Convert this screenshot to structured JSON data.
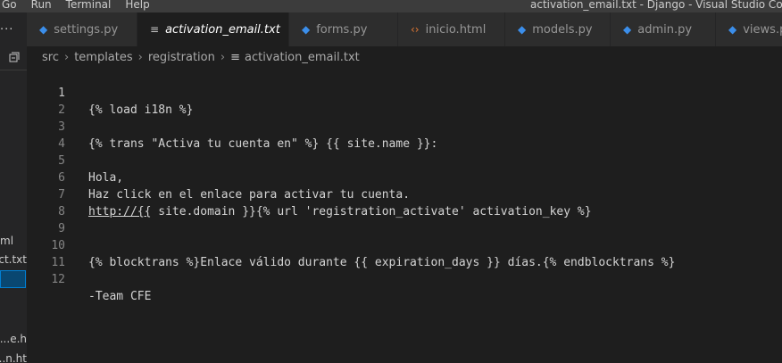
{
  "titlebar": {
    "menus": [
      "Go",
      "Run",
      "Terminal",
      "Help"
    ],
    "window_title": "activation_email.txt - Django - Visual Studio Code"
  },
  "sidebar": {
    "header": "...",
    "files": [
      "ml",
      "ct.txt",
      "e.h...",
      "n.ht..."
    ]
  },
  "tabs": [
    {
      "label": "settings.py",
      "icon": "python-file-icon",
      "color": "#3b8eea"
    },
    {
      "label": "activation_email.txt",
      "icon": "text-file-icon",
      "active": true
    },
    {
      "label": "forms.py",
      "icon": "python-file-icon",
      "color": "#3b8eea"
    },
    {
      "label": "inicio.html",
      "icon": "html-file-icon",
      "color": "#e37933"
    },
    {
      "label": "models.py",
      "icon": "python-file-icon",
      "color": "#3b8eea"
    },
    {
      "label": "admin.py",
      "icon": "python-file-icon",
      "color": "#3b8eea"
    },
    {
      "label": "views.p",
      "icon": "python-file-icon",
      "color": "#3b8eea"
    }
  ],
  "close_glyph": "✕",
  "breadcrumb": [
    "src",
    "templates",
    "registration",
    "activation_email.txt"
  ],
  "editor": {
    "current_line": 1,
    "lines": [
      {
        "n": "1",
        "text": "{% load i18n %}"
      },
      {
        "n": "2",
        "text": ""
      },
      {
        "n": "3",
        "text": "{% trans \"Activa tu cuenta en\" %} {{ site.name }}:"
      },
      {
        "n": "4",
        "text": ""
      },
      {
        "n": "5",
        "text": "Hola,"
      },
      {
        "n": "6",
        "text": "Haz click en el enlace para activar tu cuenta."
      },
      {
        "n": "7",
        "link": "http://{{",
        "text": " site.domain }}{% url 'registration_activate' activation_key %}"
      },
      {
        "n": "8",
        "text": ""
      },
      {
        "n": "9",
        "text": ""
      },
      {
        "n": "10",
        "text": "{% blocktrans %}Enlace válido durante {{ expiration_days }} días.{% endblocktrans %}"
      },
      {
        "n": "11",
        "text": ""
      },
      {
        "n": "12",
        "text": "-Team CFE"
      }
    ]
  }
}
